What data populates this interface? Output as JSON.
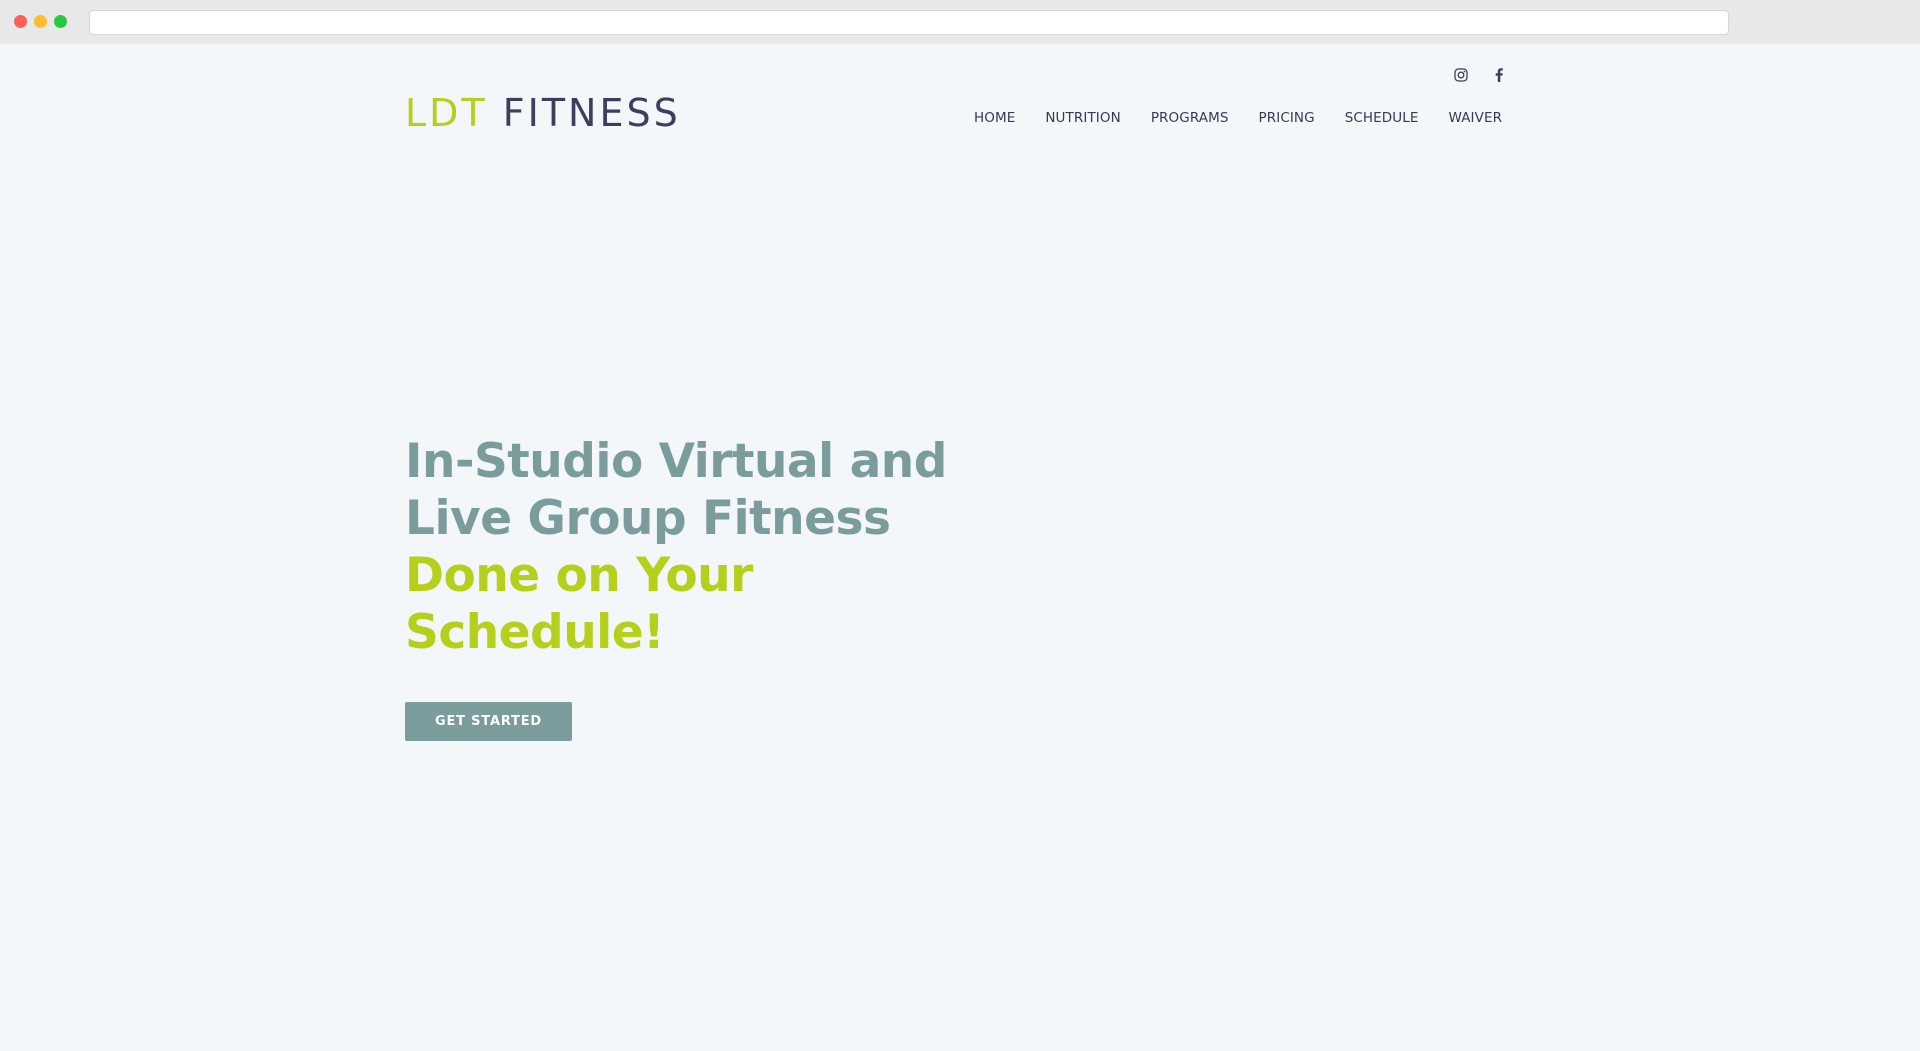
{
  "browser": {
    "address": ""
  },
  "header": {
    "logo": {
      "part1": "LDT",
      "part2": "FITNESS"
    },
    "social": [
      {
        "icon": "instagram-icon"
      },
      {
        "icon": "facebook-icon"
      }
    ],
    "nav": [
      {
        "label": "HOME"
      },
      {
        "label": "NUTRITION"
      },
      {
        "label": "PROGRAMS"
      },
      {
        "label": "PRICING"
      },
      {
        "label": "SCHEDULE"
      },
      {
        "label": "WAIVER"
      }
    ]
  },
  "hero": {
    "title_lines": [
      {
        "text": "In-Studio Virtual and",
        "style": "muted"
      },
      {
        "text": "Live Group Fitness",
        "style": "muted"
      },
      {
        "text": "Done on Your",
        "style": "accent"
      },
      {
        "text": "Schedule!",
        "style": "accent"
      }
    ],
    "cta_label": "GET STARTED"
  },
  "colors": {
    "accent": "#b5cf1b",
    "muted": "#7b9c9d",
    "dark": "#3a3f5e",
    "background": "#f3f7fa"
  }
}
